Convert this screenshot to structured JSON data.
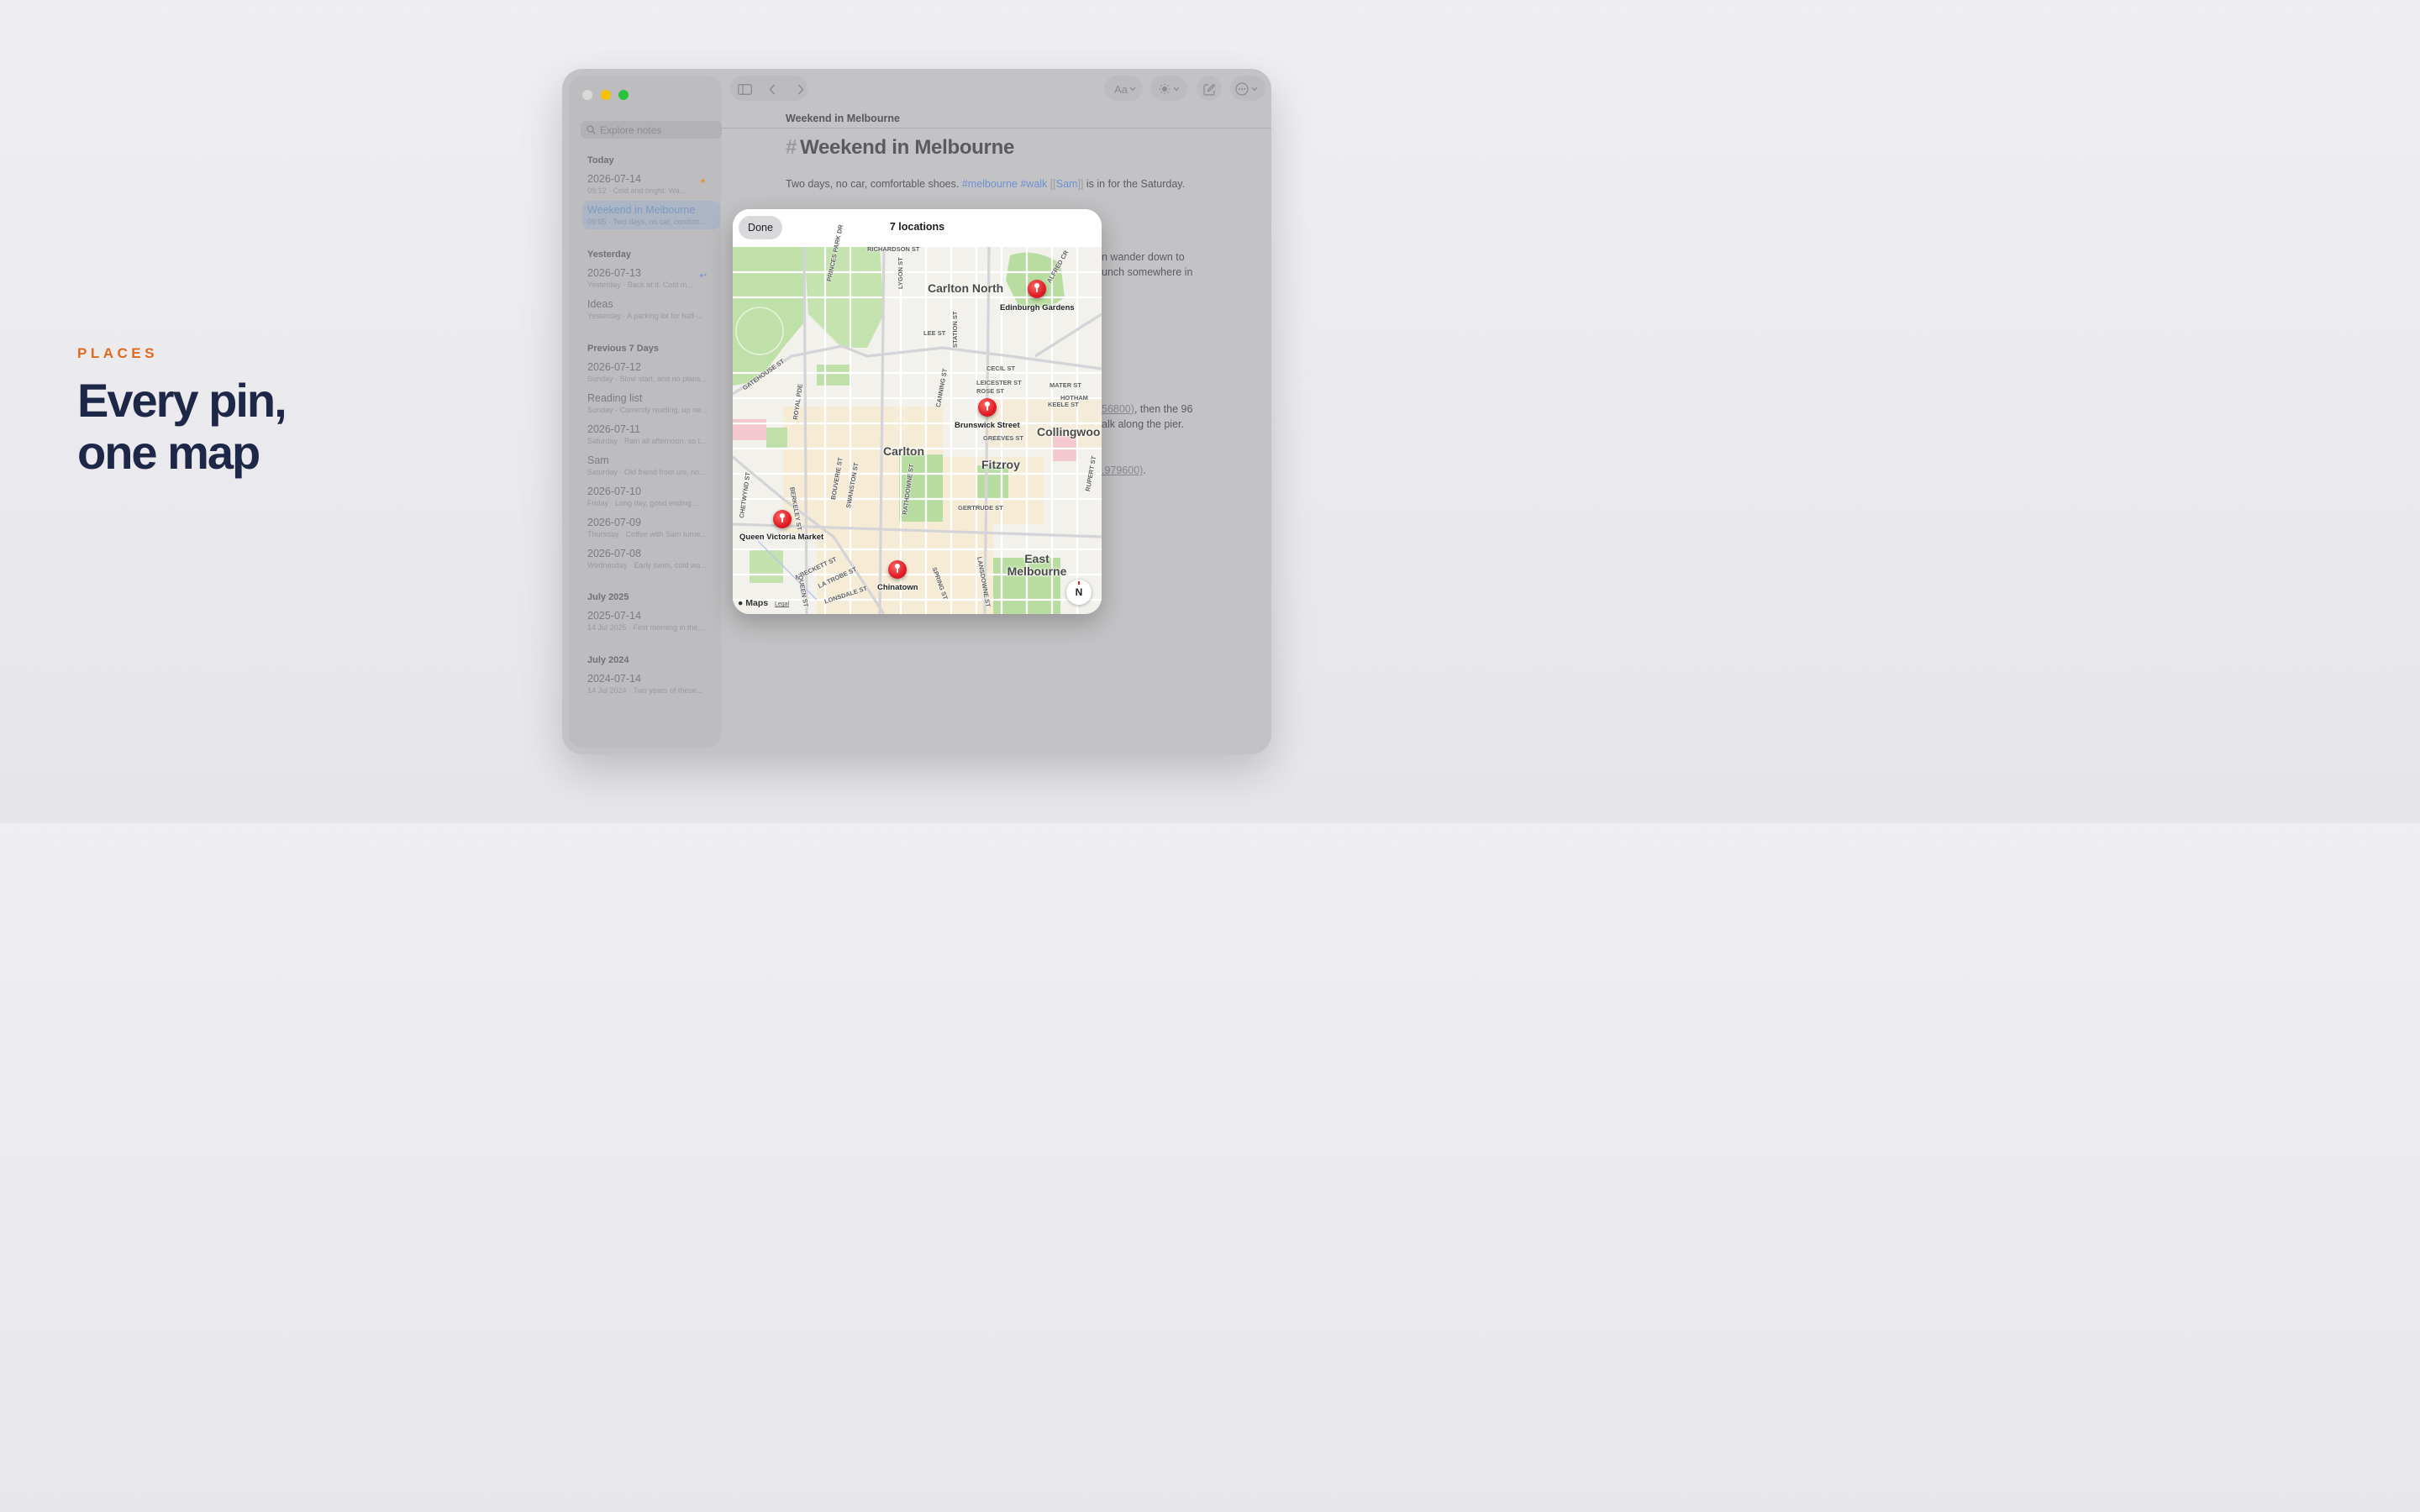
{
  "promo": {
    "eyebrow": "PLACES",
    "headline_line1": "Every pin,",
    "headline_line2": "one map"
  },
  "toolbar": {
    "sidebar_toggle_icon": "sidebar-icon",
    "back_icon": "chevron-left-icon",
    "forward_icon": "chevron-right-icon",
    "font_label": "Aa",
    "appearance_icon": "sun-icon",
    "compose_icon": "compose-icon",
    "more_icon": "ellipsis-icon"
  },
  "sidebar": {
    "search_placeholder": "Explore notes",
    "sections": [
      {
        "title": "Today",
        "notes": [
          {
            "title": "2026-07-14",
            "subtitle": "09:12 · Cold and bright. Walk...",
            "badge": "☀"
          },
          {
            "title": "Weekend in Melbourne",
            "subtitle": "09:05 · Two days, no car, comfort...",
            "active": true
          }
        ]
      },
      {
        "title": "Yesterday",
        "notes": [
          {
            "title": "2026-07-13",
            "subtitle": "Yesterday · Back at it. Cold m...",
            "badge": "↩"
          },
          {
            "title": "Ideas",
            "subtitle": "Yesterday · A parking lot for half-..."
          }
        ]
      },
      {
        "title": "Previous 7 Days",
        "notes": [
          {
            "title": "2026-07-12",
            "subtitle": "Sunday · Slow start, and no plans..."
          },
          {
            "title": "Reading list",
            "subtitle": "Sunday · Currently reading, up ne..."
          },
          {
            "title": "2026-07-11",
            "subtitle": "Saturday · Rain all afternoon, so t..."
          },
          {
            "title": "Sam",
            "subtitle": "Saturday · Old friend from uni, no..."
          },
          {
            "title": "2026-07-10",
            "subtitle": "Friday · Long day, good ending..."
          },
          {
            "title": "2026-07-09",
            "subtitle": "Thursday · Coffee with Sam turne..."
          },
          {
            "title": "2026-07-08",
            "subtitle": "Wednesday · Early swim, cold wa..."
          }
        ]
      },
      {
        "title": "July 2025",
        "notes": [
          {
            "title": "2025-07-14",
            "subtitle": "14 Jul 2025 · First morning in the..."
          }
        ]
      },
      {
        "title": "July 2024",
        "notes": [
          {
            "title": "2024-07-14",
            "subtitle": "14 Jul 2024 · Two years of these..."
          }
        ]
      }
    ]
  },
  "document": {
    "breadcrumb": "Weekend in Melbourne",
    "heading_hash": "#",
    "heading": "Weekend in Melbourne",
    "para1_text": "Two days, no car, comfortable shoes.",
    "para1_tag1": "#melbourne",
    "para1_tag2": "#walk",
    "para1_link": "Sam",
    "para1_bracket_open": "[[",
    "para1_bracket_close": "]]",
    "para1_tail": "is in for the Saturday.",
    "frag_wander": "n wander down to",
    "frag_lunch": "unch somewhere in",
    "frag_coord1": "56800)",
    "frag_the96": ", then the 96",
    "frag_pier": "alk along the pier.",
    "frag_coord2": ".979600)",
    "frag_period": "."
  },
  "modal": {
    "done_label": "Done",
    "title": "7 locations",
    "maps_brand": "Maps",
    "legal": "Legal",
    "compass": "N",
    "pins": [
      {
        "label": "Edinburgh Gardens"
      },
      {
        "label": "Brunswick Street"
      },
      {
        "label": "Queen Victoria Market"
      },
      {
        "label": "Chinatown"
      }
    ],
    "suburbs": [
      "Carlton North",
      "Carlton",
      "Fitzroy",
      "Collingwoo",
      "East Melbourne"
    ],
    "streets": [
      "RICHARDSON ST",
      "PRINCES PARK DR",
      "LYGON ST",
      "LEE ST",
      "STATION ST",
      "ALFRED CR",
      "GATEHOUSE ST",
      "ROYAL PDE",
      "CECIL ST",
      "LEICESTER ST",
      "ROSE ST",
      "MATER ST",
      "HOTHAM",
      "KEELE ST",
      "GREEVES ST",
      "CANNING ST",
      "BERKELEY ST",
      "BOUVERIE ST",
      "SWANSTON ST",
      "RATHDOWNE ST",
      "GERTRUDE ST",
      "CHETWYND ST",
      "A'BECKETT ST",
      "LA TROBE ST",
      "LONSDALE ST",
      "QUEEN ST",
      "SPRING ST",
      "LANSDOWNE ST",
      "RUPERT ST"
    ]
  }
}
